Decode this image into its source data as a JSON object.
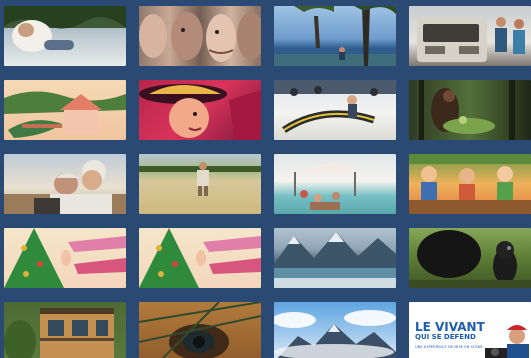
{
  "theme": {
    "background": "#2b4a73"
  },
  "gallery": {
    "tiles": [
      {
        "subject": "person-lying-in-grass"
      },
      {
        "subject": "faces-closeup-collage"
      },
      {
        "subject": "seaside-trees-people"
      },
      {
        "subject": "van-and-couple"
      },
      {
        "subject": "illustrated-house-and-hand"
      },
      {
        "subject": "illustrated-woman-with-hat"
      },
      {
        "subject": "snow-sled-race"
      },
      {
        "subject": "forest-gatherer"
      },
      {
        "subject": "elderly-couple-illustration"
      },
      {
        "subject": "man-in-wheat-field"
      },
      {
        "subject": "market-beach-stalls"
      },
      {
        "subject": "cartoon-market-vendors"
      },
      {
        "subject": "christmas-tree-illustration"
      },
      {
        "subject": "christmas-tree-illustration"
      },
      {
        "subject": "mountain-lake"
      },
      {
        "subject": "black-squirrel"
      },
      {
        "subject": "wooden-house"
      },
      {
        "subject": "animal-eye-closeup"
      },
      {
        "subject": "mountain-peaks-clouds"
      },
      {
        "subject": "poster-le-vivant",
        "poster": {
          "title_line1": "LE VIVANT",
          "title_line2": "QUI SE DÉFEND",
          "subtitle": "UNE EXPÉRIENCE DE MISE EN SCÈNE"
        }
      }
    ]
  }
}
